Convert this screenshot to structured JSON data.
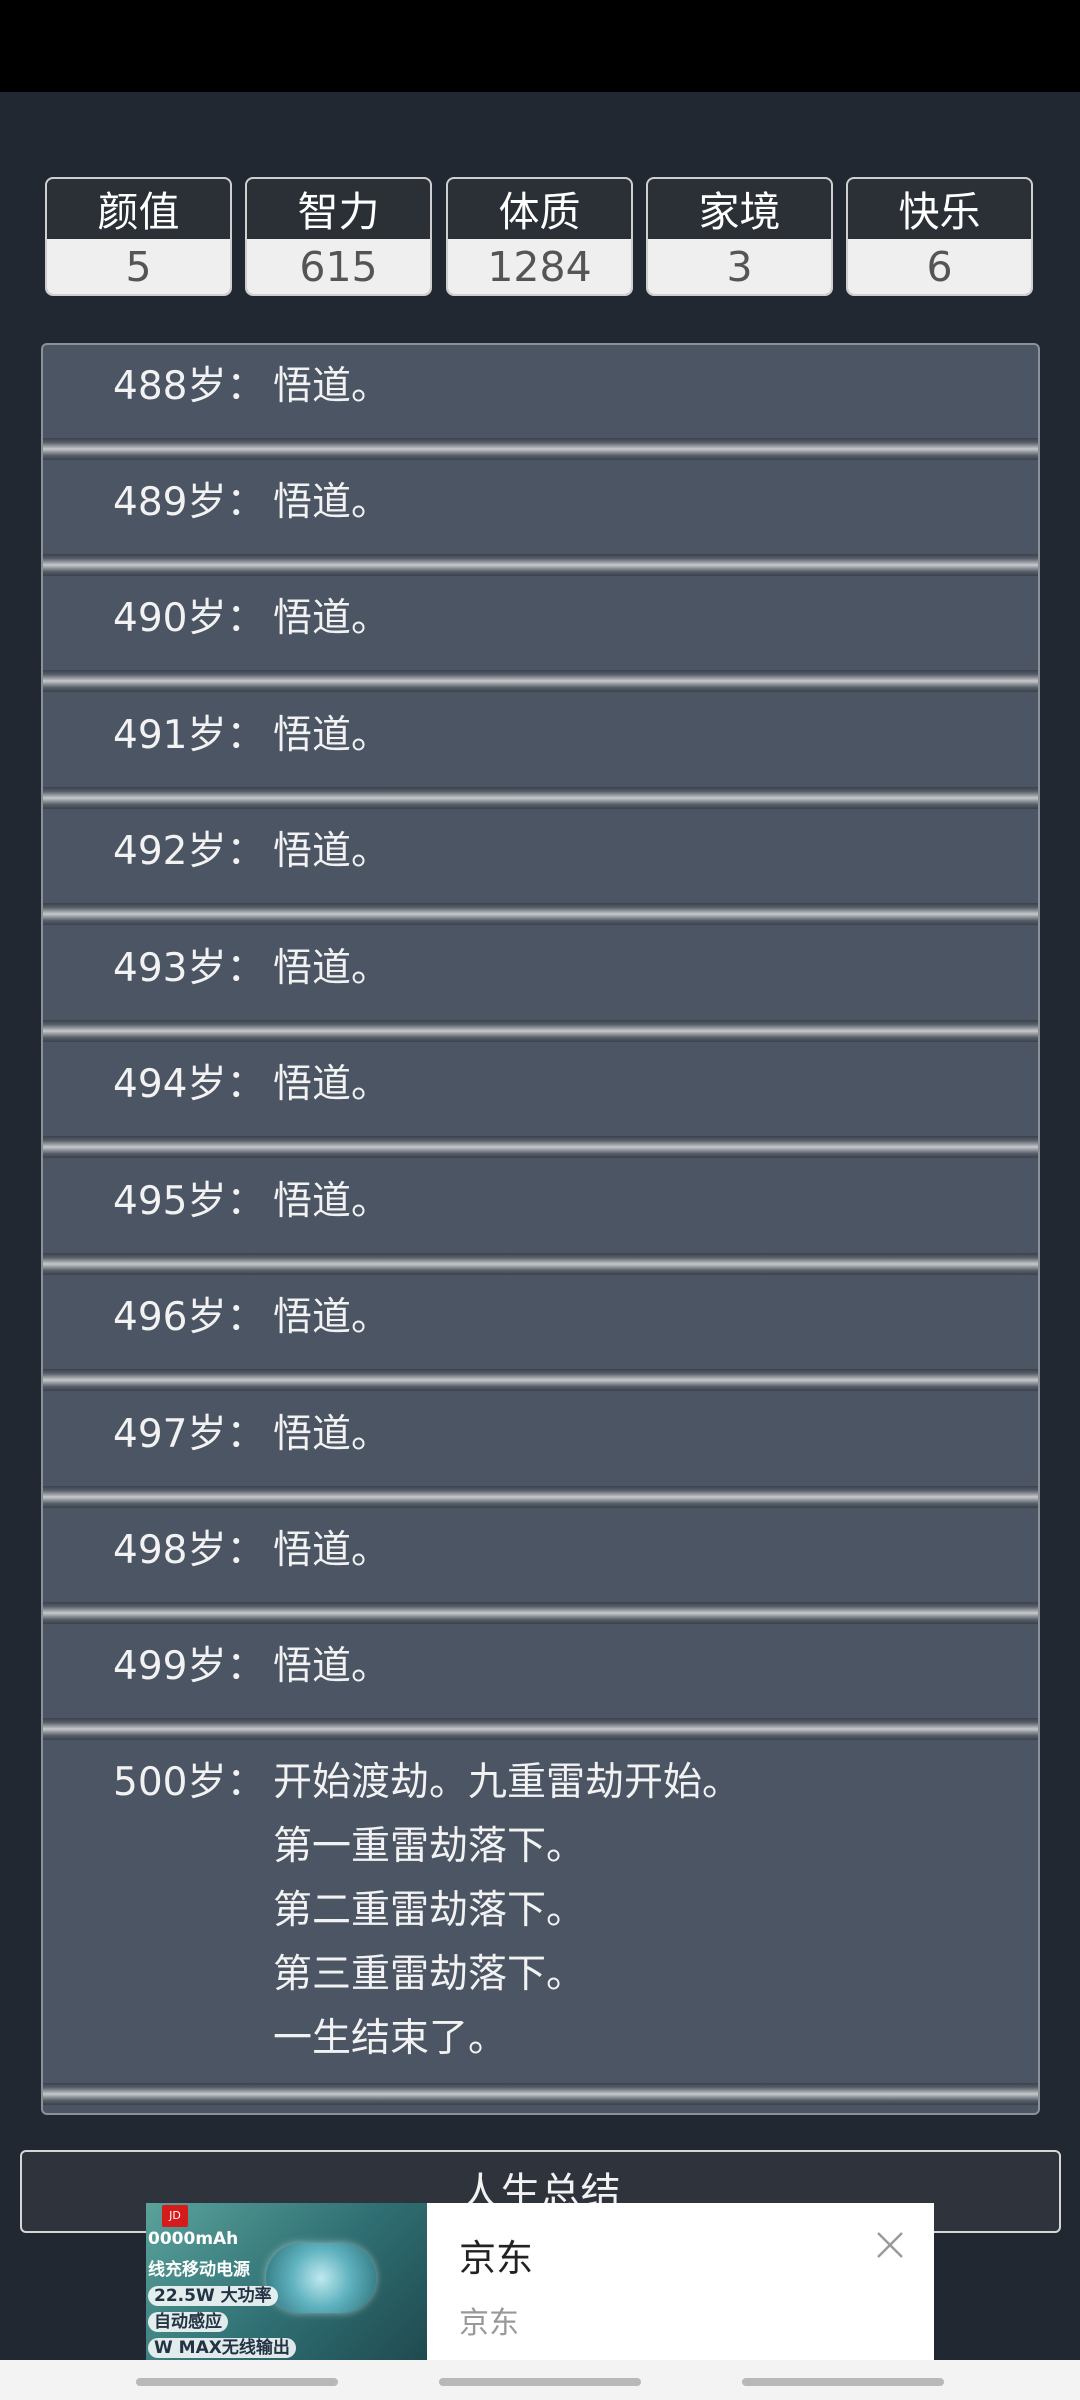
{
  "stats": [
    {
      "label": "颜值",
      "value": "5"
    },
    {
      "label": "智力",
      "value": "615"
    },
    {
      "label": "体质",
      "value": "1284"
    },
    {
      "label": "家境",
      "value": "3"
    },
    {
      "label": "快乐",
      "value": "6"
    }
  ],
  "log": [
    {
      "age": "488岁：",
      "events": [
        "悟道。"
      ]
    },
    {
      "age": "489岁：",
      "events": [
        "悟道。"
      ]
    },
    {
      "age": "490岁：",
      "events": [
        "悟道。"
      ]
    },
    {
      "age": "491岁：",
      "events": [
        "悟道。"
      ]
    },
    {
      "age": "492岁：",
      "events": [
        "悟道。"
      ]
    },
    {
      "age": "493岁：",
      "events": [
        "悟道。"
      ]
    },
    {
      "age": "494岁：",
      "events": [
        "悟道。"
      ]
    },
    {
      "age": "495岁：",
      "events": [
        "悟道。"
      ]
    },
    {
      "age": "496岁：",
      "events": [
        "悟道。"
      ]
    },
    {
      "age": "497岁：",
      "events": [
        "悟道。"
      ]
    },
    {
      "age": "498岁：",
      "events": [
        "悟道。"
      ]
    },
    {
      "age": "499岁：",
      "events": [
        "悟道。"
      ]
    },
    {
      "age": "500岁：",
      "events": [
        "开始渡劫。九重雷劫开始。",
        "第一重雷劫落下。",
        "第二重雷劫落下。",
        "第三重雷劫落下。",
        "一生结束了。"
      ]
    }
  ],
  "summary_button": "人生总结",
  "ad": {
    "title": "京东",
    "subtitle": "京东",
    "image_text": [
      "0000mAh",
      "线充移动电源",
      "22.5W 大功率",
      "自动感应",
      "W MAX无线输出"
    ]
  }
}
